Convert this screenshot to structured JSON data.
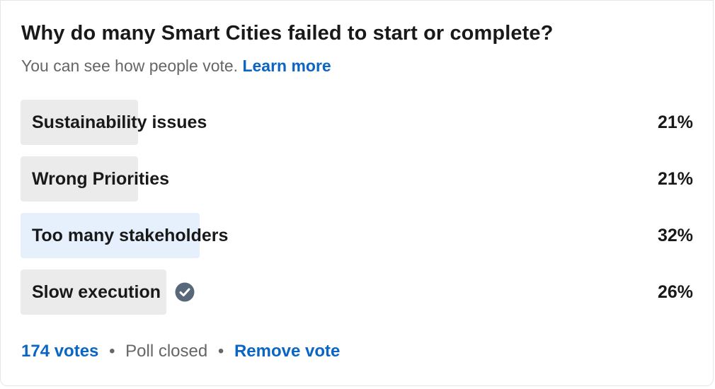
{
  "poll": {
    "question": "Why do many Smart Cities failed to start or complete?",
    "subtitle": "You can see how people vote.",
    "learn_more": "Learn more",
    "options": [
      {
        "label": "Sustainability issues",
        "percent_text": "21%",
        "percent": 21,
        "selected": false,
        "winner": false
      },
      {
        "label": "Wrong Priorities",
        "percent_text": "21%",
        "percent": 21,
        "selected": false,
        "winner": false
      },
      {
        "label": "Too many stakeholders",
        "percent_text": "32%",
        "percent": 32,
        "selected": false,
        "winner": true
      },
      {
        "label": "Slow execution",
        "percent_text": "26%",
        "percent": 26,
        "selected": true,
        "winner": false
      }
    ],
    "votes": "174 votes",
    "status": "Poll closed",
    "separator": "•",
    "remove_vote": "Remove vote"
  },
  "icons": {
    "selected_check": "check-circle-icon"
  },
  "colors": {
    "accent": "#0a66c2",
    "bar_default": "#ebebeb",
    "bar_winner": "#e6f0fc",
    "check_fill": "#56687a"
  }
}
